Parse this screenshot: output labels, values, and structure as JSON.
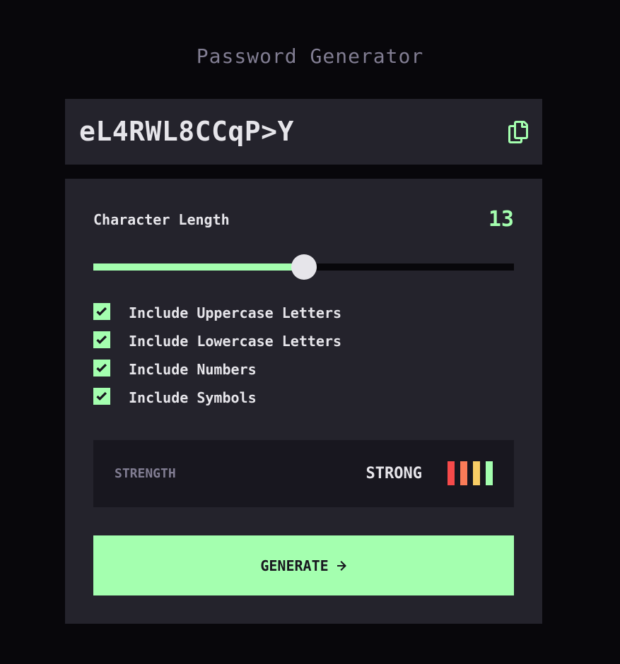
{
  "app": {
    "title": "Password Generator"
  },
  "password": {
    "value": "eL4RWL8CCqP>Y",
    "copy_icon": "copy-icon"
  },
  "length": {
    "label": "Character Length",
    "value": "13",
    "fraction": 0.5
  },
  "options": [
    {
      "label": "Include Uppercase Letters",
      "checked": true
    },
    {
      "label": "Include Lowercase Letters",
      "checked": true
    },
    {
      "label": "Include Numbers",
      "checked": true
    },
    {
      "label": "Include Symbols",
      "checked": true
    }
  ],
  "strength": {
    "label": "STRENGTH",
    "value": "STRONG",
    "bar_colors": [
      "#f64a4a",
      "#fb7c58",
      "#f8cd65",
      "#a4ffaf"
    ]
  },
  "generate": {
    "label": "GENERATE",
    "icon": "arrow-right-icon"
  },
  "colors": {
    "accent": "#a4ffaf",
    "background": "#08070b",
    "panel": "#24232c",
    "panel_dark": "#18171f",
    "muted": "#817d92",
    "text": "#e6e5ea"
  }
}
